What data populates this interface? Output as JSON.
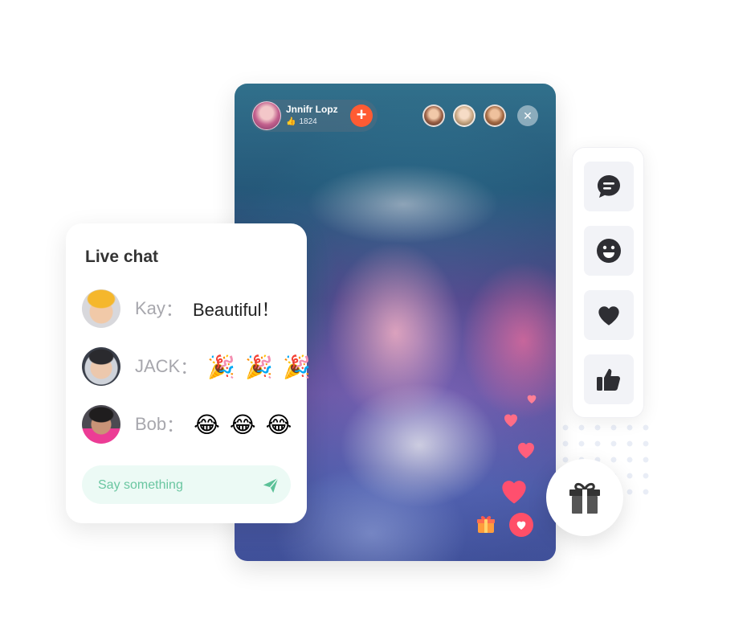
{
  "host": {
    "name": "Jnnifr Lopz",
    "count": "1824",
    "count_icon": "thumbs-up-icon"
  },
  "viewers": [
    "viewer-avatar",
    "viewer-avatar",
    "viewer-avatar"
  ],
  "colors": {
    "accent_orange": "#ff5b33",
    "heart_pink": "#ff4f68",
    "composer_bg": "#ecfaf5",
    "composer_text": "#6ac6a1",
    "panel_bg": "#f2f3f7",
    "icon_dark": "#2e2e33"
  },
  "actions": [
    {
      "icon": "chat-bubble-icon"
    },
    {
      "icon": "smiley-icon"
    },
    {
      "icon": "heart-icon"
    },
    {
      "icon": "thumbs-up-icon"
    }
  ],
  "chat": {
    "title": "Live chat",
    "separator": "：",
    "messages": [
      {
        "user": "Kay",
        "text": "Beautiful！"
      },
      {
        "user": "JACK",
        "emojis": [
          "🎉",
          "🎉",
          "🎉"
        ]
      },
      {
        "user": "Bob",
        "emojis": [
          "😂",
          "😂",
          "😂"
        ]
      }
    ],
    "placeholder": "Say something"
  }
}
